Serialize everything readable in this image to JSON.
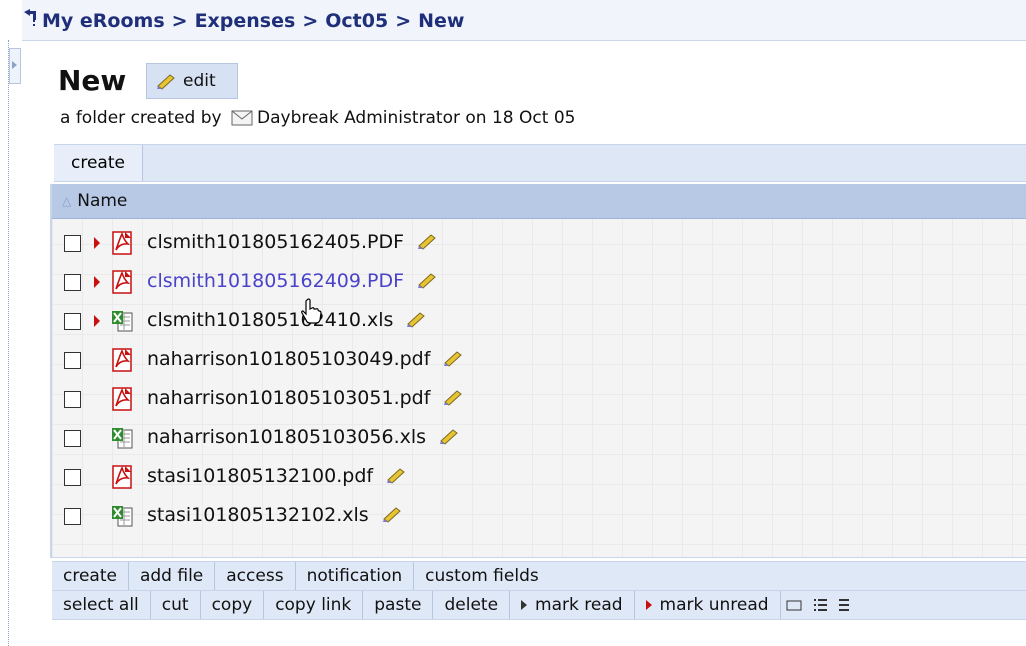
{
  "breadcrumb": {
    "items": [
      "My eRooms",
      "Expenses",
      "Oct05",
      "New"
    ],
    "separator": ">"
  },
  "folder": {
    "title": "New",
    "edit_label": "edit",
    "created_prefix": "a folder created by",
    "author": "Daybreak Administrator",
    "date_text": "on 18 Oct 05"
  },
  "create_tab_label": "create",
  "list": {
    "column_name": "Name",
    "files": [
      {
        "name": "clsmith101805162405.PDF",
        "type": "pdf",
        "unread": true,
        "link": false
      },
      {
        "name": "clsmith101805162409.PDF",
        "type": "pdf",
        "unread": true,
        "link": true
      },
      {
        "name": "clsmith101805162410.xls",
        "type": "xls",
        "unread": true,
        "link": false
      },
      {
        "name": "naharrison101805103049.pdf",
        "type": "pdf",
        "unread": false,
        "link": false
      },
      {
        "name": "naharrison101805103051.pdf",
        "type": "pdf",
        "unread": false,
        "link": false
      },
      {
        "name": "naharrison101805103056.xls",
        "type": "xls",
        "unread": false,
        "link": false
      },
      {
        "name": "stasi101805132100.pdf",
        "type": "pdf",
        "unread": false,
        "link": false
      },
      {
        "name": "stasi101805132102.xls",
        "type": "xls",
        "unread": false,
        "link": false
      }
    ]
  },
  "toolbar1": [
    "create",
    "add file",
    "access",
    "notification",
    "custom fields"
  ],
  "toolbar2": {
    "select_all": "select all",
    "cut": "cut",
    "copy": "copy",
    "copy_link": "copy link",
    "paste": "paste",
    "delete": "delete",
    "mark_read": "mark read",
    "mark_unread": "mark unread"
  },
  "colors": {
    "breadcrumb": "#1f2f7a",
    "link": "#4a43c9",
    "unread_marker": "#c81010",
    "header": "#b8c9e6"
  }
}
